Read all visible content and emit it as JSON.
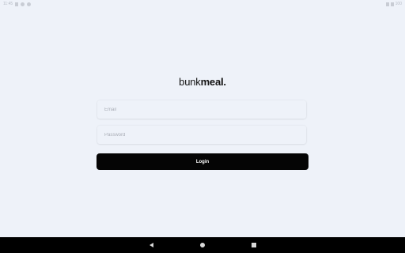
{
  "status_bar": {
    "time": "11:45",
    "battery_text": "100",
    "left_icons": [
      "notification-icon",
      "settings-icon",
      "sync-icon"
    ],
    "right_icons": [
      "wifi-icon",
      "battery-icon"
    ]
  },
  "logo": {
    "part1": "bunk",
    "part2": "meal."
  },
  "form": {
    "email_placeholder": "Email",
    "password_placeholder": "Password",
    "login_label": "Login"
  },
  "nav_bar": {
    "icons": [
      "back-icon",
      "home-icon",
      "recents-icon"
    ]
  },
  "colors": {
    "background": "#eef2f9",
    "button": "#050505",
    "button_text": "#ffffff"
  }
}
